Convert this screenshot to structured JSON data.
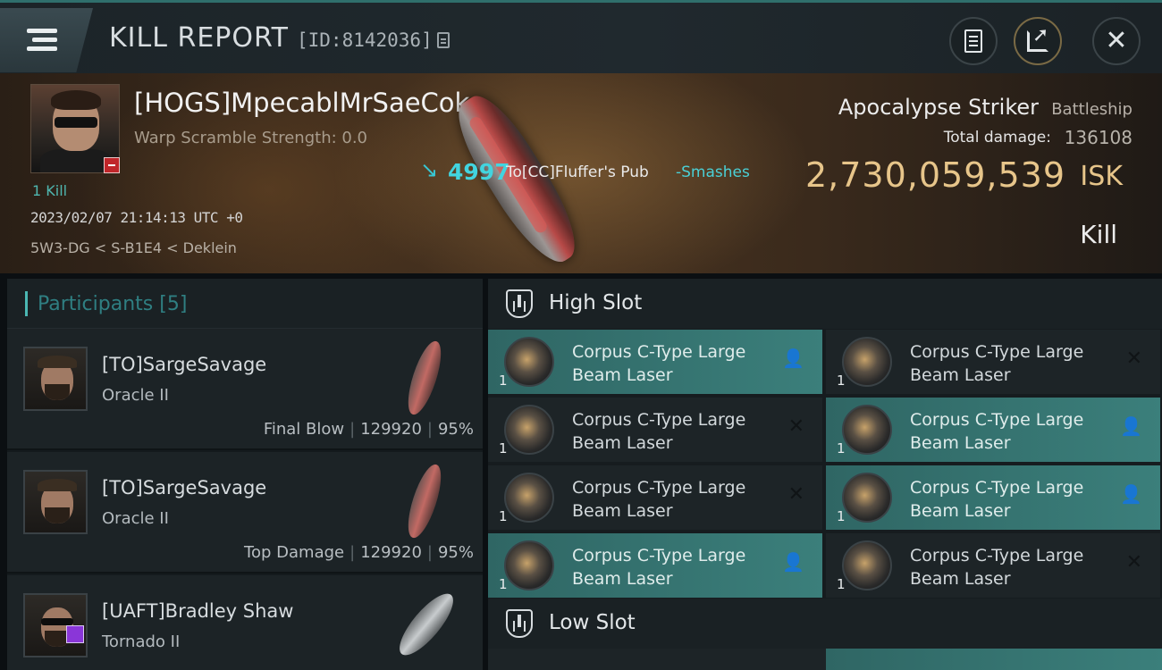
{
  "header": {
    "title": "KILL REPORT",
    "report_id": "[ID:8142036]"
  },
  "victim": {
    "name": "[HOGS]MpecablMrSaeCok",
    "warp_scramble": "Warp Scramble Strength: 0.0",
    "kills": "1 Kill",
    "timestamp": "2023/02/07 21:14:13 UTC +0",
    "location": "5W3-DG < S-B1E4 < Deklein",
    "ship_name": "Apocalypse Striker",
    "ship_class": "Battleship",
    "total_damage_label": "Total damage:",
    "total_damage": "136108",
    "isk_value": "2,730,059,539",
    "isk_unit": "ISK",
    "result": "Kill"
  },
  "damage_event": {
    "amount": "4997",
    "target": "To[CC]Fluffer's Pub",
    "verb": "-Smashes"
  },
  "participants": {
    "title": "Participants",
    "count": "[5]",
    "rows": [
      {
        "name": "[TO]SargeSavage",
        "ship": "Oracle II",
        "role": "Final Blow",
        "damage": "129920",
        "percent": "95%"
      },
      {
        "name": "[TO]SargeSavage",
        "ship": "Oracle II",
        "role": "Top Damage",
        "damage": "129920",
        "percent": "95%"
      },
      {
        "name": "[UAFT]Bradley Shaw",
        "ship": "Tornado II"
      }
    ]
  },
  "high_slot": {
    "title": "High Slot",
    "modules": [
      {
        "name": "Corpus C-Type Large Beam Laser",
        "qty": "1",
        "state": "active"
      },
      {
        "name": "Corpus C-Type Large Beam Laser",
        "qty": "1",
        "state": "destroyed"
      },
      {
        "name": "Corpus C-Type Large Beam Laser",
        "qty": "1",
        "state": "destroyed"
      },
      {
        "name": "Corpus C-Type Large Beam Laser",
        "qty": "1",
        "state": "active"
      },
      {
        "name": "Corpus C-Type Large Beam Laser",
        "qty": "1",
        "state": "destroyed"
      },
      {
        "name": "Corpus C-Type Large Beam Laser",
        "qty": "1",
        "state": "active"
      },
      {
        "name": "Corpus C-Type Large Beam Laser",
        "qty": "1",
        "state": "active"
      },
      {
        "name": "Corpus C-Type Large Beam Laser",
        "qty": "1",
        "state": "destroyed"
      }
    ]
  },
  "low_slot": {
    "title": "Low Slot"
  },
  "icons": {
    "menu": "menu-icon",
    "copy": "copy-icon",
    "doc": "document-icon",
    "share": "share-icon",
    "close": "close-icon",
    "slot": "slot-shield-icon",
    "dropped": "person-icon",
    "destroyed": "x-icon"
  },
  "colors": {
    "accent": "#4bb7b3",
    "isk": "#e7c58a",
    "damage": "#42d4df",
    "active_module": "#3b7f7b"
  }
}
